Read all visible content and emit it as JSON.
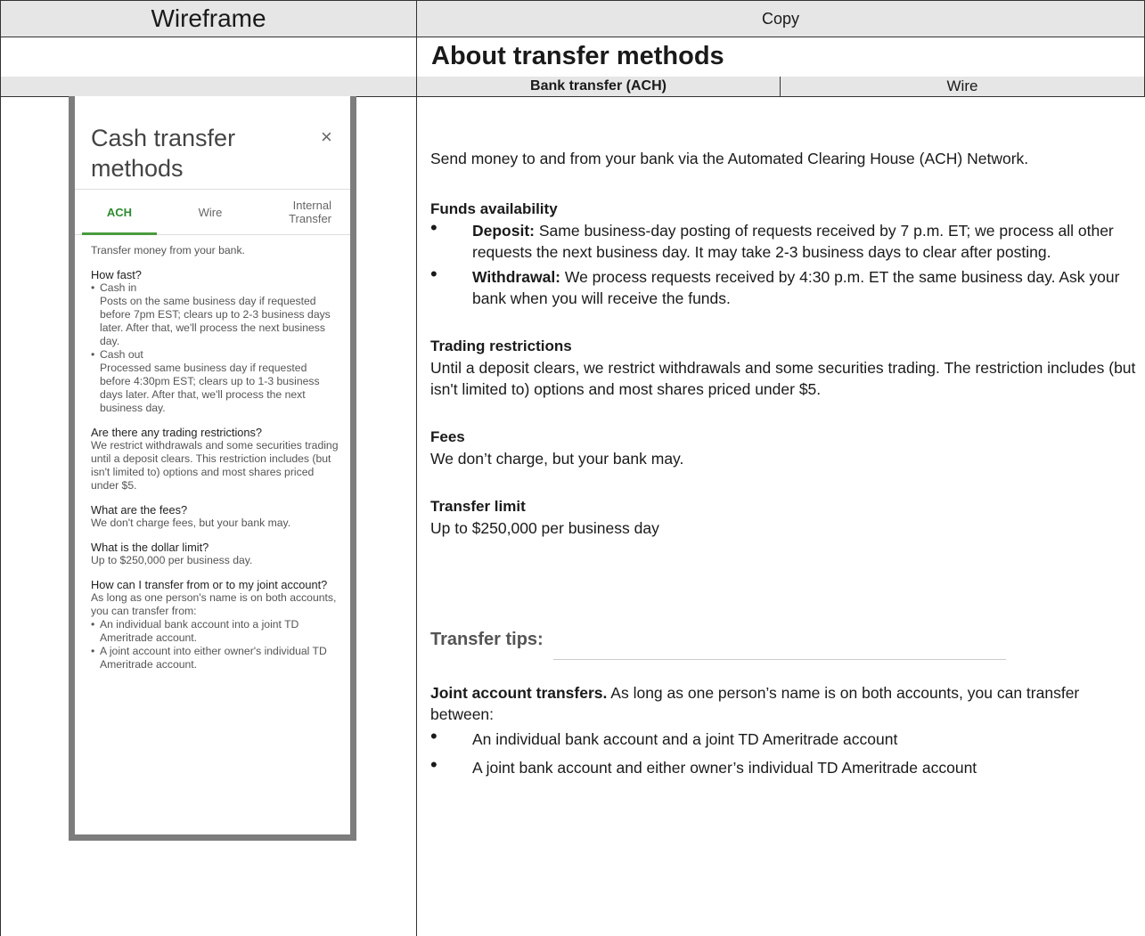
{
  "header": {
    "wireframe_label": "Wireframe",
    "copy_label": "Copy"
  },
  "page_title": "About transfer methods",
  "tabs": {
    "ach": "Bank transfer (ACH)",
    "wire": "Wire"
  },
  "wireframe": {
    "title": "Cash transfer methods",
    "close_glyph": "×",
    "tabs": [
      "ACH",
      "Wire",
      "Internal Transfer"
    ],
    "intro": "Transfer money from your bank.",
    "how_fast_q": "How fast?",
    "cash_in_label": "Cash in",
    "cash_in_text": "Posts on the same business day if requested before 7pm EST; clears up to 2-3 business days later. After that, we'll process the next business day.",
    "cash_out_label": "Cash out",
    "cash_out_text": "Processed same business day if requested before 4:30pm EST; clears up to 1-3 business days later. After that, we'll process the next business day.",
    "restrictions_q": "Are there any trading restrictions?",
    "restrictions_text": "We restrict withdrawals and some securities trading until a deposit clears. This restriction includes (but isn't limited to) options and most shares priced under $5.",
    "fees_q": "What are the fees?",
    "fees_text": "We don't charge fees, but your bank may.",
    "limit_q": "What is the dollar limit?",
    "limit_text": "Up to $250,000 per business day.",
    "joint_q": "How can I transfer from or to my joint account?",
    "joint_text": "As long as one person's name is on both accounts, you can transfer from:",
    "joint_items": [
      "An individual bank account into a joint TD Ameritrade account.",
      "A joint account into either owner's individual TD Ameritrade account."
    ]
  },
  "copy": {
    "intro": "Send money to and from your bank via the Automated Clearing House (ACH) Network.",
    "funds_heading": "Funds availability",
    "deposit_label": "Deposit:",
    "deposit_text": " Same business-day posting of requests received by 7 p.m. ET; we process all other requests the next business day. It may take 2-3 business days to clear after posting.",
    "withdrawal_label": "Withdrawal:",
    "withdrawal_text": " We process requests received by 4:30 p.m. ET the same business day. Ask your bank when you will receive the funds.",
    "restrictions_heading": "Trading restrictions",
    "restrictions_text": "Until a deposit clears, we restrict withdrawals and some securities trading. The restriction includes (but isn't limited to) options and most shares priced under $5.",
    "fees_heading": "Fees",
    "fees_text": "We don’t charge, but your bank may.",
    "limit_heading": "Transfer limit",
    "limit_text": "Up to $250,000 per business day",
    "tips_heading": "Transfer tips:",
    "joint_label": "Joint account transfers.",
    "joint_text": " As long as one person’s name is on both accounts, you can transfer between:",
    "joint_items": [
      "An individual bank account and a joint TD Ameritrade account",
      "A joint bank account and either owner’s individual TD Ameritrade account"
    ]
  }
}
